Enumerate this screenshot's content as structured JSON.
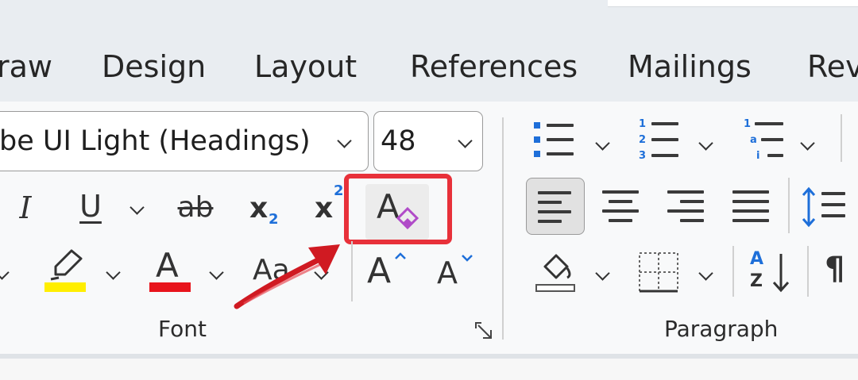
{
  "tabs": [
    {
      "label": "raw"
    },
    {
      "label": "Design"
    },
    {
      "label": "Layout"
    },
    {
      "label": "References"
    },
    {
      "label": "Mailings"
    },
    {
      "label": "Rev"
    }
  ],
  "font": {
    "name_value": "be UI Light (Headings)",
    "size_value": "48",
    "group_label": "Font",
    "buttons": {
      "italic": "I",
      "underline": "U",
      "strikethrough": "ab",
      "subscript_base": "x",
      "subscript_mark": "2",
      "superscript_base": "x",
      "superscript_mark": "2",
      "clear_formatting": "A",
      "font_color": "A",
      "change_case": "Aa",
      "grow_font": "A",
      "shrink_font": "A"
    },
    "colors": {
      "highlight": "#ffee00",
      "font_color": "#e8141c",
      "eraser": "#b04bc8"
    }
  },
  "paragraph": {
    "group_label": "Paragraph",
    "numbering_digits": [
      "1",
      "2",
      "3"
    ],
    "multilevel_marks": [
      "1",
      "a",
      "i"
    ],
    "sort_letters": [
      "A",
      "Z"
    ],
    "pilcrow": "¶"
  },
  "annotation": {
    "highlight_color": "#e8313a",
    "arrow_color": "#d01a22"
  }
}
